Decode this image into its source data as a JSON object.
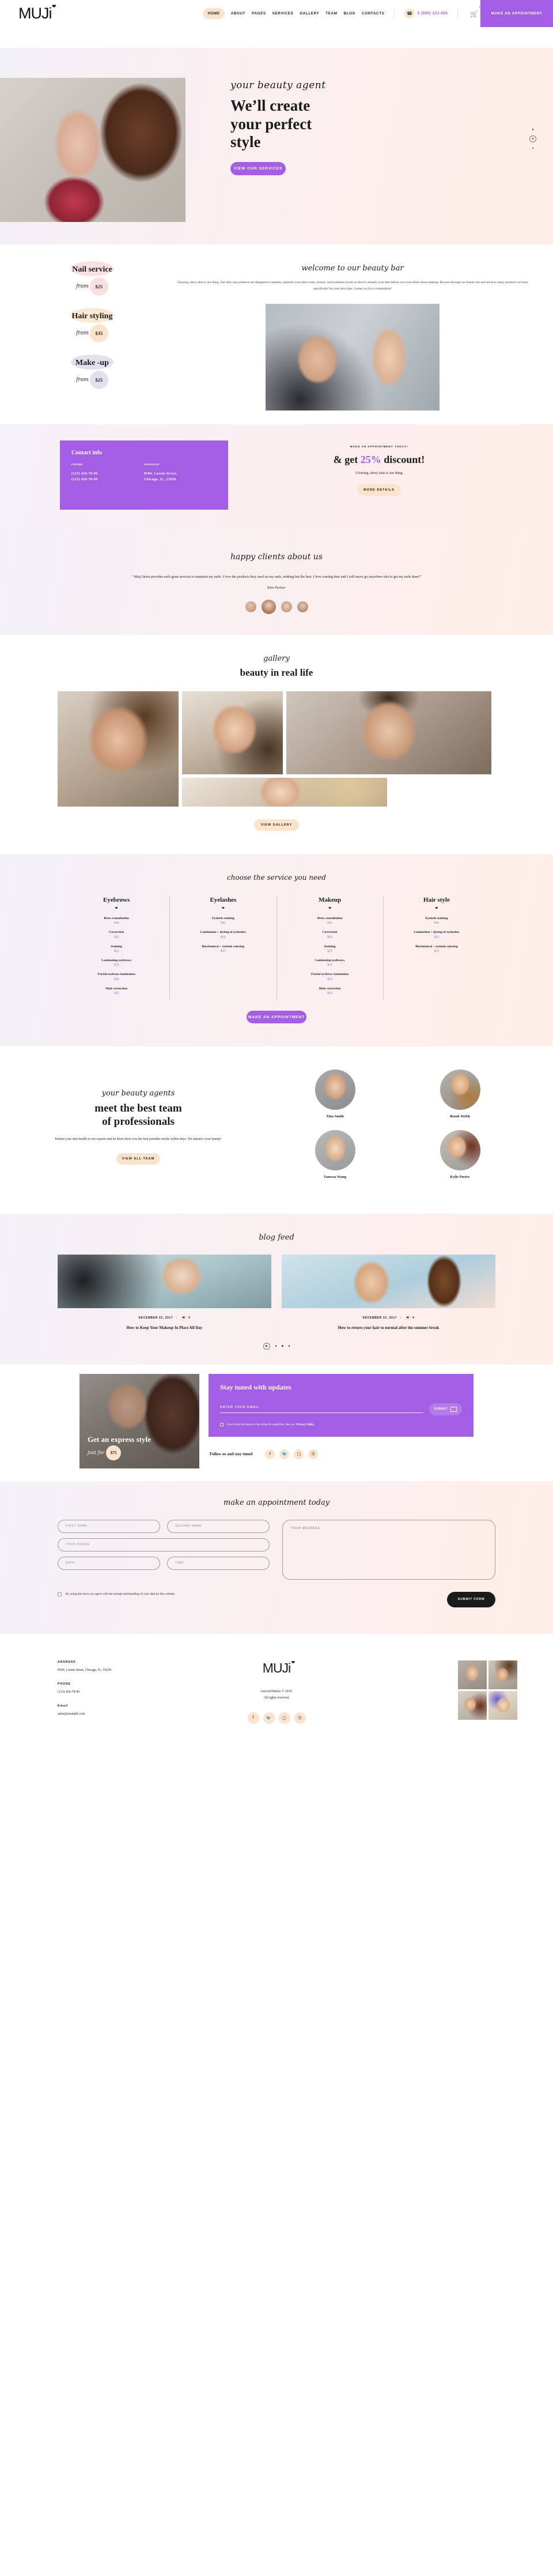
{
  "header": {
    "logo": "MUJi",
    "nav": [
      {
        "label": "HOME",
        "active": true
      },
      {
        "label": "ABOUT",
        "active": false
      },
      {
        "label": "PAGES",
        "active": false
      },
      {
        "label": "SERVICES",
        "active": false
      },
      {
        "label": "GALLERY",
        "active": false
      },
      {
        "label": "TEAM",
        "active": false
      },
      {
        "label": "BLOG",
        "active": false
      },
      {
        "label": "CONTACTS",
        "active": false
      }
    ],
    "phone": "0 (800) 123-456",
    "cart_count": "0",
    "appointment_button": "MAKE AN APPOINTMENT"
  },
  "hero": {
    "kicker": "your beauty agent",
    "title_line1": "We’ll create",
    "title_line2": "your perfect",
    "title_line3": "style",
    "cta": "VIEW OUR SERVICES"
  },
  "about": {
    "services": [
      {
        "name": "Nail service",
        "from": "from",
        "price": "$25",
        "blob": "#fbe0e3",
        "circle": "#fadfe1"
      },
      {
        "name": "Hair styling",
        "from": "from",
        "price": "$35",
        "blob": "#fbe9d3",
        "circle": "#fbe3cc"
      },
      {
        "name": "Make -up",
        "from": "from",
        "price": "$25",
        "blob": "#e4e1ef",
        "circle": "#e2dfee"
      }
    ],
    "script": "welcome to our beauty bar",
    "copy": "Glowing, dewy skin is our thing. Our skin care products are designed to instantly optimize your skin's tone, texture, and hydration levels so that it's already at its best before you even think about makeup. Browse through our beauty bar and see how many products we have specifically for your skin type. Contact us for a consultation!"
  },
  "contact": {
    "title": "Contact info",
    "phone_label": "PHONE",
    "address_label": "ADDRESS",
    "phone1": "(123) 456-78-90",
    "phone2": "(123) 456-78-90",
    "address1": "8500, Lorem Street,",
    "address2": "Chicago, IL, 55030"
  },
  "discount": {
    "kicker": "MAKE AN APPOINTMENT TODAY!",
    "head_pre": "& get ",
    "head_em": "25%",
    "head_post": " discount!",
    "sub": "Glowing, dewy skin is our thing",
    "cta": "MORE DETAILS"
  },
  "testimonial": {
    "script": "happy clients about us",
    "quote": "“ Muji Salon provides such great services to maintain my nails. I love the products they used on my nails, nothing but the best. I love coming here and I will never go anywhere else to get my nails done!”",
    "name": "Kim Parker"
  },
  "gallery": {
    "script": "gallery",
    "title": "beauty in real life",
    "cta": "VIEW GALLERY"
  },
  "service_table": {
    "script": "choose the service you need",
    "cta": "MAKE AN APPOINTMENT",
    "columns": [
      {
        "title": "Eyebrows",
        "items": [
          {
            "name": "Brow consultation",
            "price": "free"
          },
          {
            "name": "Correction",
            "price": "$35"
          },
          {
            "name": "Staining",
            "price": "$25"
          },
          {
            "name": "Laminating eyebrows",
            "price": "$15"
          },
          {
            "name": "Partial eyebrow lamination",
            "price": "$50"
          },
          {
            "name": "Male correction",
            "price": "$25"
          }
        ]
      },
      {
        "title": "Eyelashes",
        "items": [
          {
            "name": "Eyelash staining",
            "price": "free"
          },
          {
            "name": "Lamination + dyeing of eyelashes",
            "price": "$35"
          },
          {
            "name": "Biochemical + eyelash coloring",
            "price": "$25"
          }
        ]
      },
      {
        "title": "Makeup",
        "items": [
          {
            "name": "Brow consultation",
            "price": "free"
          },
          {
            "name": "Correction",
            "price": "$35"
          },
          {
            "name": "Staining",
            "price": "$25"
          },
          {
            "name": "Laminating eyebrows",
            "price": "$15"
          },
          {
            "name": "Partial eyebrow lamination",
            "price": "$50"
          },
          {
            "name": "Male correction",
            "price": "$25"
          }
        ]
      },
      {
        "title": "Hair style",
        "items": [
          {
            "name": "Eyelash staining",
            "price": "free"
          },
          {
            "name": "Lamination + dyeing of eyelashes",
            "price": "$35"
          },
          {
            "name": "Biochemical + eyelash coloring",
            "price": "$25"
          }
        ]
      }
    ]
  },
  "team": {
    "script": "your beauty agents",
    "title_line1": "meet the best team",
    "title_line2": "of professionals",
    "copy": "Entrust your skin health to our experts and let them show you the best possible results within days. We enhance your beauty!",
    "cta": "VIEW ALL TEAM",
    "members": [
      {
        "name": "Tina Smith"
      },
      {
        "name": "Brook Welsh"
      },
      {
        "name": "Vanessa Wang"
      },
      {
        "name": "Kylie Porter"
      }
    ]
  },
  "blog": {
    "script": "blog feed",
    "posts": [
      {
        "date": "DECEMBER 22, 2017",
        "likes": "0",
        "title": "How to Keep Your Makeup In Place All Day"
      },
      {
        "date": "DECEMBER 22, 2017",
        "likes": "4",
        "title": "How to return your hair to normal after the summer break"
      }
    ]
  },
  "promo": {
    "title": "Get an express style",
    "just_for": "just for",
    "price": "$75"
  },
  "subscribe": {
    "title": "Stay tuned with updates",
    "email_placeholder": "ENTER YOUR EMAIL",
    "submit": "SUBMIT",
    "agree_text": "I have read and agree to the terms & conditions. See our ",
    "privacy": "Privacy Policy",
    "follow_label": "Follow us and stay tuned",
    "socials": [
      "facebook-icon",
      "twitter-icon",
      "instagram-icon",
      "pinterest-icon"
    ]
  },
  "appointment_form": {
    "script": "make an appointment today",
    "first_name": "FIRST NAME",
    "second_name": "SECOND NAME",
    "phone": "YOUR PHONE",
    "date": "DATE",
    "time": "TIME",
    "message": "YOUR MESSAGE",
    "agree": "By using this form you agree with the storage and handling of your data by this website.",
    "submit": "SUBMIT FORM"
  },
  "footer": {
    "address_label": "ADDRESS",
    "address": "8500, Lorem Street, Chicago, IL, 55030",
    "phone_label": "PHONE",
    "phone": "(123) 456-78-90",
    "email_label": "Email",
    "email": "sales@example.com",
    "logo": "MUJi",
    "copyright_line1": "AncoraThemes © 2019.",
    "copyright_line2": "All rights reserved."
  },
  "colors": {
    "accent_purple": "#a45ee5",
    "accent_peach": "#fbe3cc",
    "text_dark": "#1b1b1b"
  }
}
